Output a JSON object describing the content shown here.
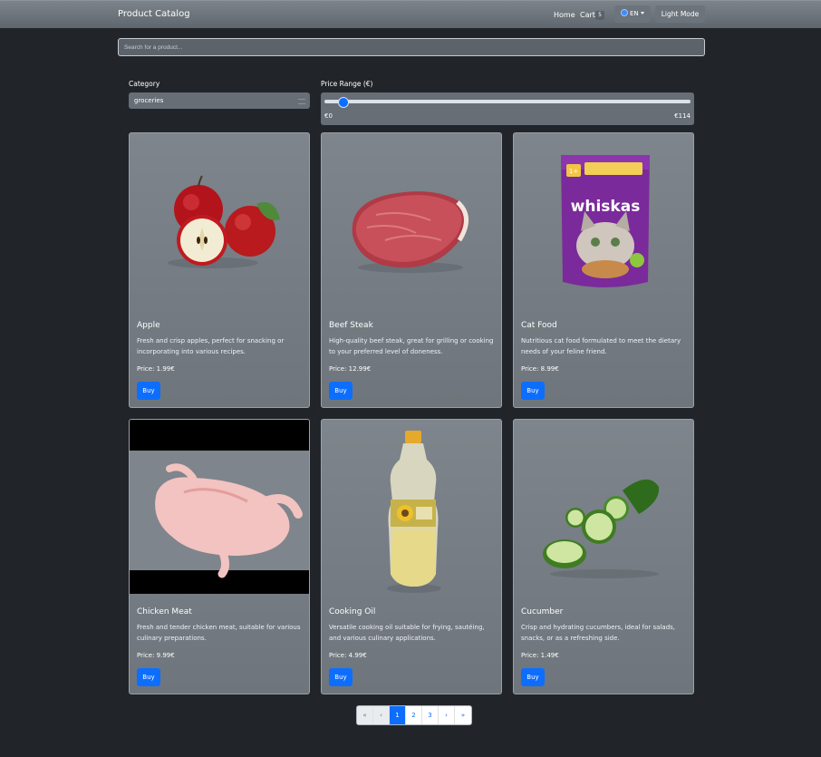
{
  "navbar": {
    "brand": "Product Catalog",
    "home": "Home",
    "cart": "Cart",
    "cart_count": "5",
    "language": "EN",
    "theme_toggle": "Light Mode"
  },
  "search": {
    "placeholder": "Search for a product..."
  },
  "filters": {
    "category_label": "Category",
    "category_value": "groceries",
    "price_label": "Price Range (€)",
    "price_min_label": "€0",
    "price_max_label": "€114",
    "price_value_fraction": 0.05
  },
  "products": [
    {
      "title": "Apple",
      "description": "Fresh and crisp apples, perfect for snacking or incorporating into various recipes.",
      "price": "Price: 1.99€",
      "buy": "Buy",
      "image_icon": "apple-image"
    },
    {
      "title": "Beef Steak",
      "description": "High-quality beef steak, great for grilling or cooking to your preferred level of doneness.",
      "price": "Price: 12.99€",
      "buy": "Buy",
      "image_icon": "steak-image"
    },
    {
      "title": "Cat Food",
      "description": "Nutritious cat food formulated to meet the dietary needs of your feline friend.",
      "price": "Price: 8.99€",
      "buy": "Buy",
      "image_icon": "cat-food-pouch-image",
      "image_text": "whiskas"
    },
    {
      "title": "Chicken Meat",
      "description": "Fresh and tender chicken meat, suitable for various culinary preparations.",
      "price": "Price: 9.99€",
      "buy": "Buy",
      "image_icon": "chicken-image"
    },
    {
      "title": "Cooking Oil",
      "description": "Versatile cooking oil suitable for frying, sautéing, and various culinary applications.",
      "price": "Price: 4.99€",
      "buy": "Buy",
      "image_icon": "oil-bottle-image"
    },
    {
      "title": "Cucumber",
      "description": "Crisp and hydrating cucumbers, ideal for salads, snacks, or as a refreshing side.",
      "price": "Price: 1.49€",
      "buy": "Buy",
      "image_icon": "cucumber-image"
    }
  ],
  "pagination": {
    "first": "«",
    "prev": "‹",
    "pages": [
      "1",
      "2",
      "3"
    ],
    "next": "›",
    "last": "»",
    "active_page": "1"
  },
  "colors": {
    "primary": "#0d6efd",
    "background": "#212529",
    "card": "#747b82"
  }
}
